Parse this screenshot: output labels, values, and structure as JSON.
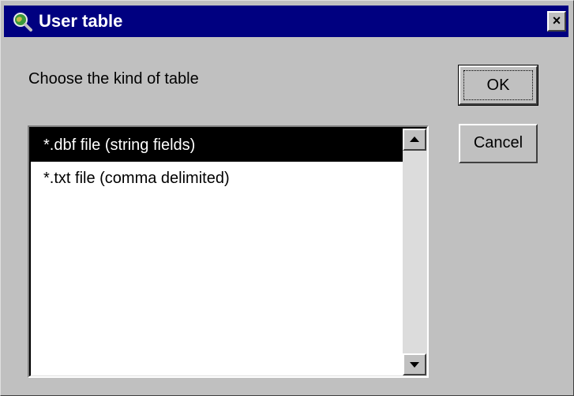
{
  "window": {
    "title": "User table",
    "close_label": "×"
  },
  "prompt": "Choose the kind of table",
  "list": {
    "items": [
      {
        "label": "*.dbf file (string fields)",
        "selected": true
      },
      {
        "label": "*.txt file (comma delimited)",
        "selected": false
      }
    ]
  },
  "buttons": {
    "ok": "OK",
    "cancel": "Cancel"
  },
  "icons": {
    "title": "globe-magnifier-icon",
    "close": "close-icon",
    "scroll_up": "arrow-up-icon",
    "scroll_down": "arrow-down-icon"
  },
  "colors": {
    "titlebar": "#000080",
    "face": "#c0c0c0",
    "selection": "#000000"
  }
}
